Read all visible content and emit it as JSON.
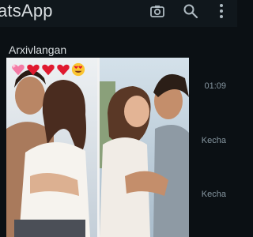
{
  "header": {
    "title": "atsApp",
    "icons": [
      "camera-icon",
      "search-icon",
      "more-vert-icon"
    ]
  },
  "list": {
    "section_label": "Arxivlangan",
    "times": [
      "01:09",
      "Kecha",
      "Kecha"
    ]
  },
  "status_image": {
    "emojis": [
      "sparkling-heart",
      "red-heart",
      "red-heart",
      "red-heart",
      "heart-eyes"
    ]
  },
  "colors": {
    "background": "#0b1014",
    "header": "#10171c",
    "secondary_text": "#8696a0",
    "heart_red": "#e0192f",
    "heart_pink": "#f47ba5"
  }
}
